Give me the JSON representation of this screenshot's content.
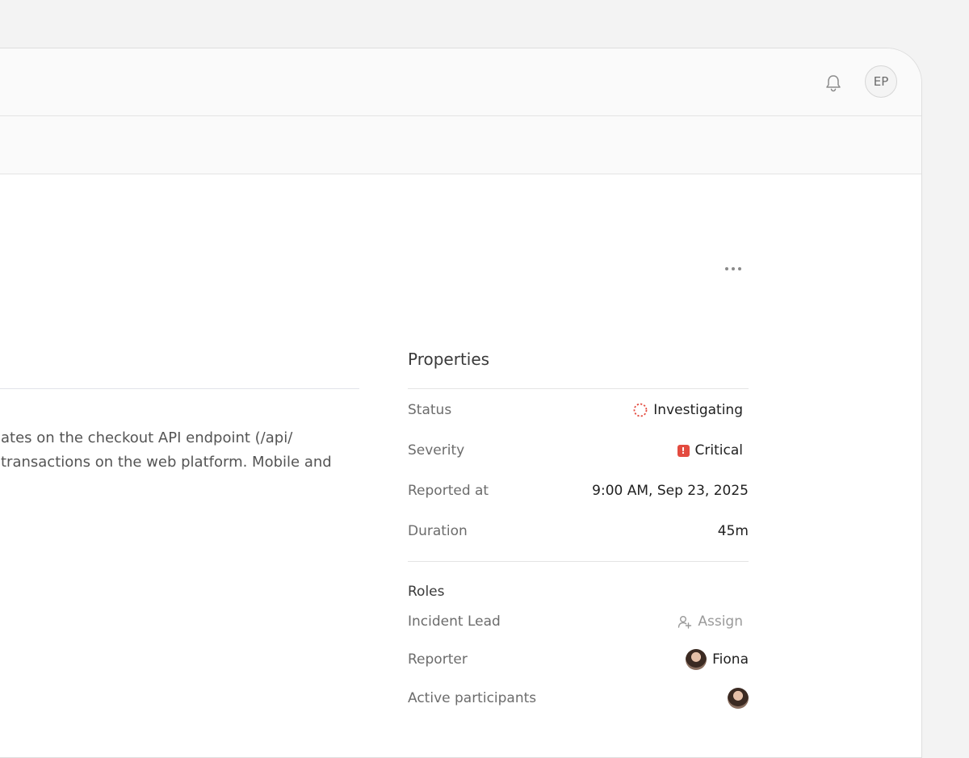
{
  "header": {
    "user_initials": "EP",
    "bell_icon": "bell-icon"
  },
  "toolbar": {
    "more_icon": "more-horizontal-icon"
  },
  "description": {
    "line_1": "ates on the checkout API endpoint (/api/",
    "line_2": "transactions on the web platform. Mobile and"
  },
  "properties": {
    "title": "Properties",
    "status": {
      "label": "Status",
      "value": "Investigating",
      "color": "#e34b3f"
    },
    "severity": {
      "label": "Severity",
      "value": "Critical",
      "color": "#e34b3f",
      "badge_glyph": "!"
    },
    "reported_at": {
      "label": "Reported at",
      "value": "9:00 AM, Sep 23, 2025"
    },
    "duration": {
      "label": "Duration",
      "value": "45m"
    }
  },
  "roles": {
    "title": "Roles",
    "incident_lead": {
      "label": "Incident Lead",
      "value": "Assign"
    },
    "reporter": {
      "label": "Reporter",
      "value": "Fiona"
    },
    "active_participants": {
      "label": "Active participants"
    }
  }
}
